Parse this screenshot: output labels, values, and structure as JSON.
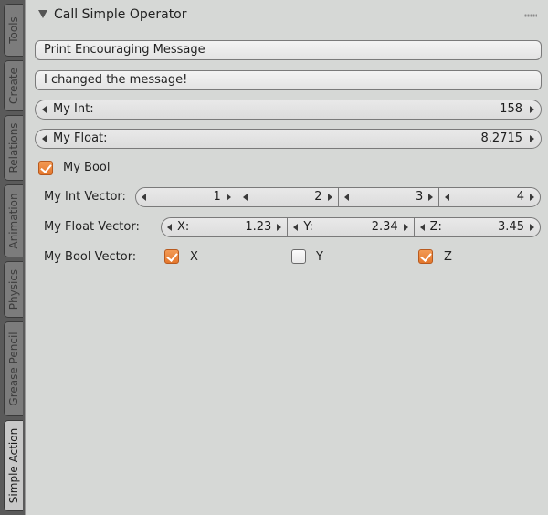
{
  "tabs": [
    "Tools",
    "Create",
    "Relations",
    "Animation",
    "Physics",
    "Grease Pencil",
    "Simple Action"
  ],
  "panel": {
    "title": "Call Simple Operator"
  },
  "buttons": {
    "print_message": "Print Encouraging Message",
    "changed_message": "I changed the message!"
  },
  "my_int": {
    "label": "My Int:",
    "value": "158"
  },
  "my_float": {
    "label": "My Float:",
    "value": "8.2715"
  },
  "my_bool": {
    "label": "My Bool",
    "checked": true
  },
  "int_vector": {
    "label": "My Int Vector:",
    "values": [
      "1",
      "2",
      "3",
      "4"
    ]
  },
  "float_vector": {
    "label": "My Float Vector:",
    "items": [
      {
        "label": "X:",
        "value": "1.23"
      },
      {
        "label": "Y:",
        "value": "2.34"
      },
      {
        "label": "Z:",
        "value": "3.45"
      }
    ]
  },
  "bool_vector": {
    "label": "My Bool Vector:",
    "items": [
      {
        "label": "X",
        "checked": true
      },
      {
        "label": "Y",
        "checked": false
      },
      {
        "label": "Z",
        "checked": true
      }
    ]
  },
  "colors": {
    "checkbox_on": "#e4772d",
    "panel_bg": "#d6d8d6"
  }
}
